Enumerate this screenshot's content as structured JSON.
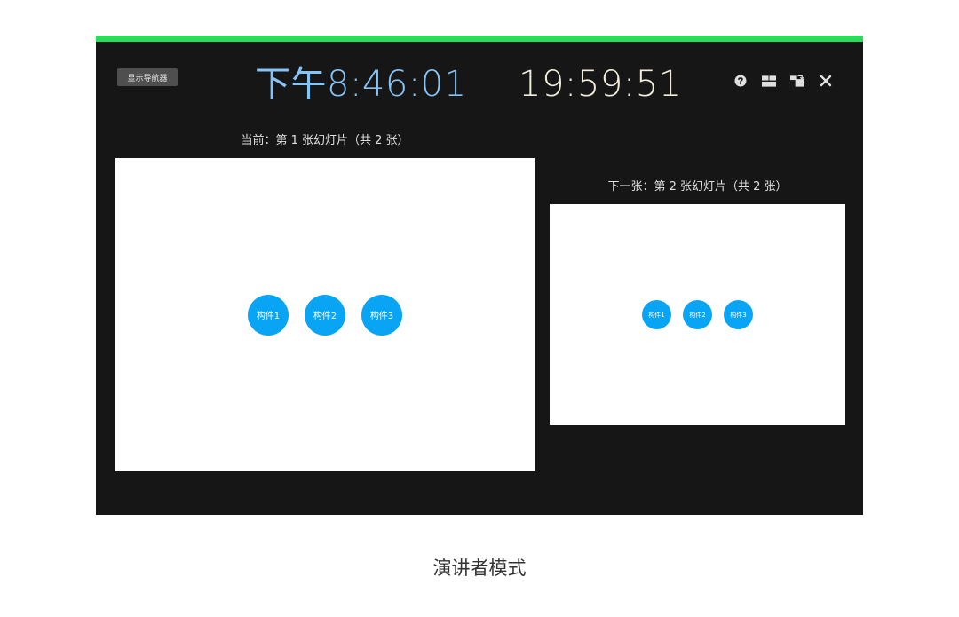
{
  "header": {
    "navigator_button": "显示导航器",
    "current_time": "下午8:46:01",
    "elapsed_time": "19:59:51",
    "icons": [
      "help-icon",
      "layout-icon",
      "swap-displays-icon",
      "close-icon"
    ]
  },
  "current_slide": {
    "label": "当前：第 1 张幻灯片（共 2 张）",
    "components": [
      "构件1",
      "构件2",
      "构件3"
    ]
  },
  "next_slide": {
    "label": "下一张：第 2 张幻灯片（共 2 张）",
    "components": [
      "构件1",
      "构件2",
      "构件3"
    ]
  },
  "caption": "演讲者模式",
  "colors": {
    "accent_bar": "#2bdb5c",
    "background": "#161616",
    "time_color": "#86c3f6",
    "elapsed_color": "#f1eddc",
    "component_color": "#0aa4f5"
  }
}
